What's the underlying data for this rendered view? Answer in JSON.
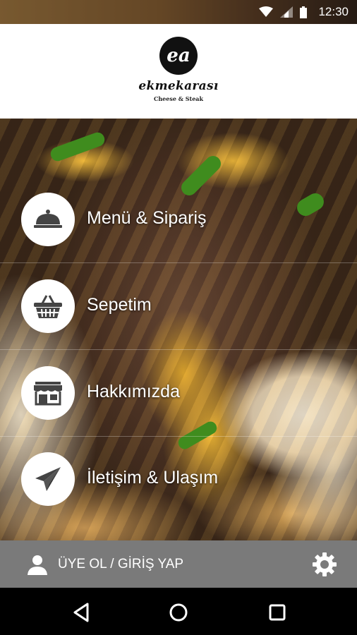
{
  "status_bar": {
    "time": "12:30",
    "icons": [
      "wifi-icon",
      "signal-icon",
      "battery-icon"
    ]
  },
  "header": {
    "logo_text": "ea",
    "brand_name": "ekmekarası",
    "tagline": "Cheese & Steak"
  },
  "menu": {
    "items": [
      {
        "label": "Menü & Sipariş",
        "icon": "cloche-icon"
      },
      {
        "label": "Sepetim",
        "icon": "basket-icon"
      },
      {
        "label": "Hakkımızda",
        "icon": "storefront-icon"
      },
      {
        "label": "İletişim & Ulaşım",
        "icon": "paper-plane-icon"
      }
    ]
  },
  "footer": {
    "login_label": "ÜYE OL / GİRİŞ YAP",
    "user_icon": "user-icon",
    "settings_icon": "gear-icon"
  },
  "nav": {
    "buttons": [
      "back-icon",
      "home-icon",
      "recents-icon"
    ]
  },
  "colors": {
    "header_bg": "#ffffff",
    "login_bar_bg": "#7a7a7a",
    "icon_color": "#444444",
    "label_color": "#ffffff"
  }
}
